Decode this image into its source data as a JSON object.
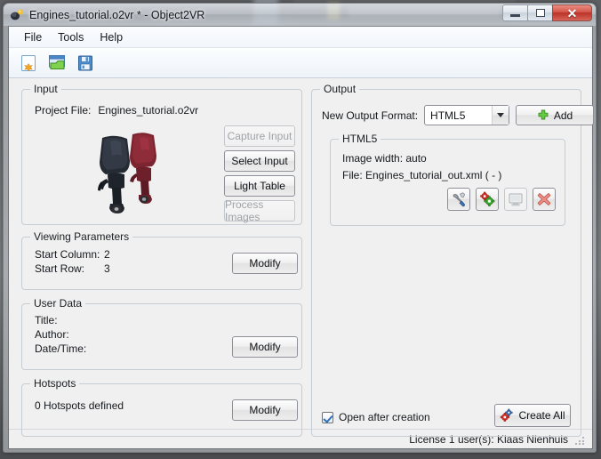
{
  "window": {
    "title": "Engines_tutorial.o2vr * - Object2VR",
    "icon": "object2vr-app-icon",
    "buttons": {
      "minimize": "minimize-icon",
      "maximize": "maximize-icon",
      "close": "✕"
    }
  },
  "menubar": {
    "items": [
      {
        "label": "File"
      },
      {
        "label": "Tools"
      },
      {
        "label": "Help"
      }
    ]
  },
  "toolbar": {
    "buttons": [
      {
        "name": "new-project-button",
        "icon": "new-document-icon",
        "tooltip": "New"
      },
      {
        "name": "open-project-button",
        "icon": "open-folder-icon",
        "tooltip": "Open"
      },
      {
        "name": "save-project-button",
        "icon": "save-floppy-icon",
        "tooltip": "Save"
      }
    ]
  },
  "input_panel": {
    "title": "Input",
    "project_file_label": "Project File:",
    "project_file_value": "Engines_tutorial.o2vr",
    "preview_alt": "two-outboard-boat-engines-thumbnail",
    "buttons": [
      {
        "label": "Capture Input",
        "enabled": false
      },
      {
        "label": "Select Input",
        "enabled": true
      },
      {
        "label": "Light Table",
        "enabled": true
      },
      {
        "label": "Process Images",
        "enabled": false
      }
    ]
  },
  "viewing_parameters": {
    "title": "Viewing Parameters",
    "start_column_label": "Start Column:",
    "start_column_value": "2",
    "start_row_label": "Start Row:",
    "start_row_value": "3",
    "modify_label": "Modify"
  },
  "user_data": {
    "title": "User Data",
    "fields": [
      {
        "label": "Title:",
        "value": ""
      },
      {
        "label": "Author:",
        "value": ""
      },
      {
        "label": "Date/Time:",
        "value": ""
      }
    ],
    "modify_label": "Modify"
  },
  "hotspots": {
    "title": "Hotspots",
    "summary": "0 Hotspots defined",
    "modify_label": "Modify"
  },
  "output_panel": {
    "title": "Output",
    "format_label": "New Output Format:",
    "format_value": "HTML5",
    "format_options": [
      "HTML5"
    ],
    "add_label": "Add",
    "add_icon": "green-plus-icon",
    "entry": {
      "title": "HTML5",
      "image_width_line": "Image width: auto",
      "file_line": "File: Engines_tutorial_out.xml ( - )",
      "actions": [
        {
          "name": "settings-tools-button",
          "icon": "screwdriver-wrench-icon",
          "enabled": true
        },
        {
          "name": "generate-button",
          "icon": "gears-icon",
          "enabled": true
        },
        {
          "name": "preview-button",
          "icon": "monitor-icon",
          "enabled": false
        },
        {
          "name": "remove-button",
          "icon": "red-x-icon",
          "enabled": true
        }
      ]
    },
    "open_after_creation_label": "Open after creation",
    "open_after_creation_checked": true,
    "create_all_label": "Create All",
    "create_all_icon": "gears-icon"
  },
  "statusbar": {
    "license_text": "License 1 user(s): Klaas Nienhuis",
    "grip": "resize-grip-icon"
  },
  "colors": {
    "accent_blue": "#2f6fb5",
    "close_red": "#b93227",
    "green": "#5cbf3a",
    "engine_dark": "#2e3440",
    "engine_red": "#7e2430"
  }
}
